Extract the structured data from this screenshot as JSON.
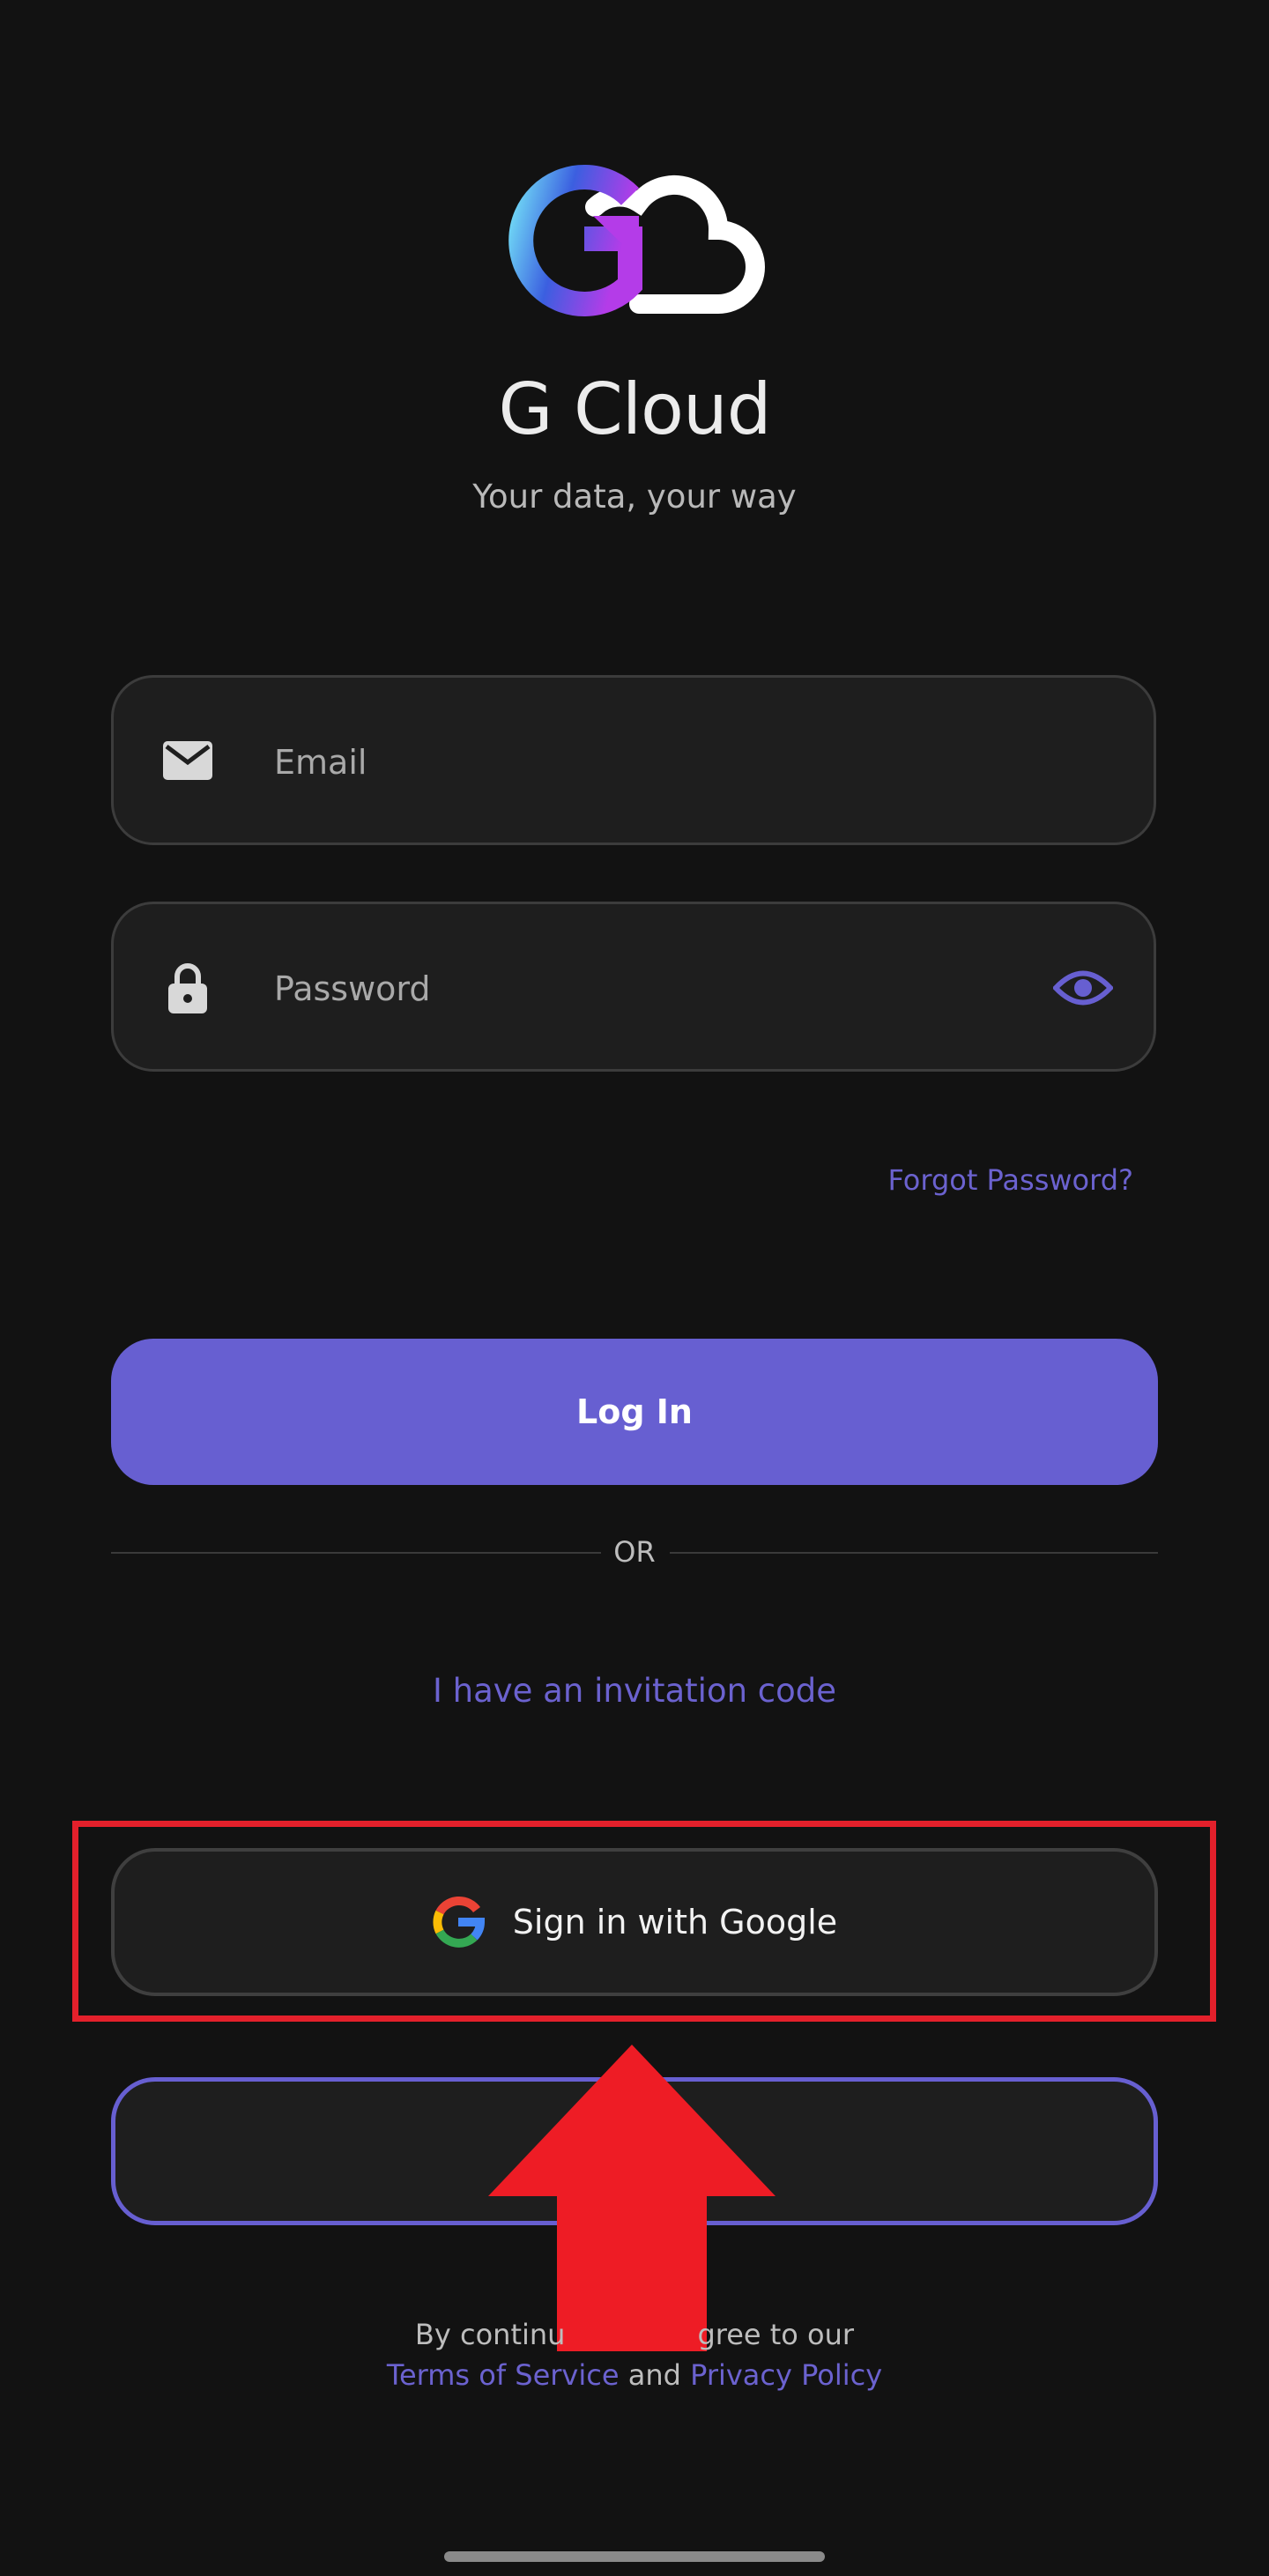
{
  "app": {
    "title": "G Cloud",
    "tagline": "Your data, your way"
  },
  "form": {
    "email_placeholder": "Email",
    "password_placeholder": "Password",
    "forgot_label": "Forgot Password?",
    "login_label": "Log In"
  },
  "divider": {
    "label": "OR"
  },
  "invite": {
    "label": "I have an invitation code"
  },
  "google": {
    "label": "Sign in with Google"
  },
  "footer": {
    "prefix_before": "By continu",
    "prefix_after": "gree to our",
    "terms_label": "Terms of Service",
    "and_label": " and ",
    "privacy_label": "Privacy Policy"
  },
  "colors": {
    "background": "#121212",
    "accent": "#675fd1",
    "field_bg": "#1e1e1e",
    "annotation_red": "#e3202b"
  },
  "icons": {
    "logo": "g-cloud-logo",
    "email": "mail-icon",
    "password": "lock-icon",
    "visibility": "eye-icon",
    "google": "google-g-icon",
    "annotation": "red-up-arrow"
  }
}
